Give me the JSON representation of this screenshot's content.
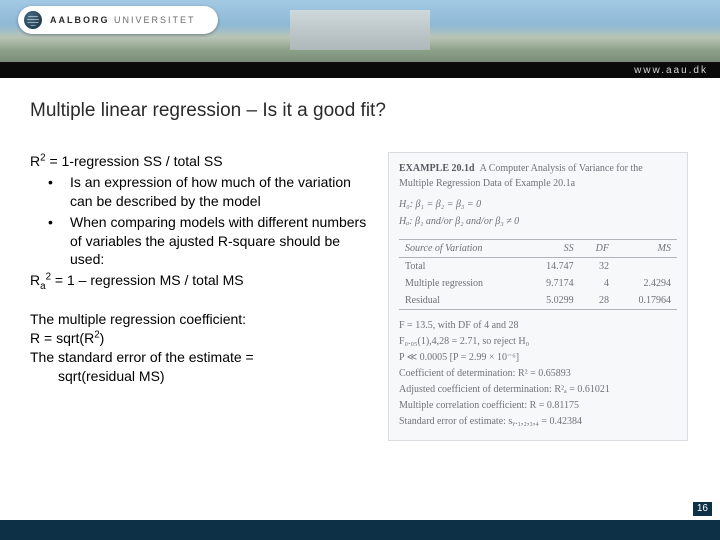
{
  "header": {
    "logo_bold": "AALBORG",
    "logo_light": "UNIVERSITET",
    "url": "www.aau.dk"
  },
  "title": "Multiple linear regression – Is it a good fit?",
  "left": {
    "r2_formula": " = 1-regression SS / total SS",
    "b1": "Is an expression of how much of the variation can be described by the model",
    "b2": "When comparing models with different numbers of variables the ajusted R-square should be used:",
    "ra2_formula": " = 1 – regression MS / total MS",
    "sec2_l1": "The multiple regression coefficient:",
    "sec2_l2_pre": "R = sqrt(R",
    "sec2_l2_post": ")",
    "sec2_l3": "The standard error of the estimate =",
    "sec2_l4": "sqrt(residual MS)"
  },
  "example": {
    "head_b": "EXAMPLE 20.1d",
    "head_rest": "A Computer Analysis of Variance for the Multiple Regression Data of Example 20.1a",
    "h0": "H₀: β₁ = β₂ = β₃ = 0",
    "ha": "Hₐ: β₁ and/or β₂ and/or β₃ ≠ 0",
    "cols": {
      "sov": "Source of Variation",
      "ss": "SS",
      "df": "DF",
      "ms": "MS"
    },
    "rows": [
      {
        "sov": "Total",
        "ss": "14.747",
        "df": "32",
        "ms": ""
      },
      {
        "sov": "Multiple regression",
        "ss": "9.7174",
        "df": "4",
        "ms": "2.4294"
      },
      {
        "sov": "Residual",
        "ss": "5.0299",
        "df": "28",
        "ms": "0.17964"
      }
    ],
    "lines": {
      "f": "F = 13.5, with DF of 4 and 28",
      "fcrit": "F₀.₀₅(1),4,28 = 2.71, so reject H₀",
      "p": "P ≪ 0.0005   [P = 2.99 × 10⁻⁶]",
      "r2": "Coefficient of determination: R² = 0.65893",
      "ra2": "Adjusted coefficient of determination: R²ₐ = 0.61021",
      "r": "Multiple correlation coefficient: R = 0.81175",
      "se": "Standard error of estimate: sᵧ.₁,₂,₃,₄ = 0.42384"
    }
  },
  "page_number": "16"
}
